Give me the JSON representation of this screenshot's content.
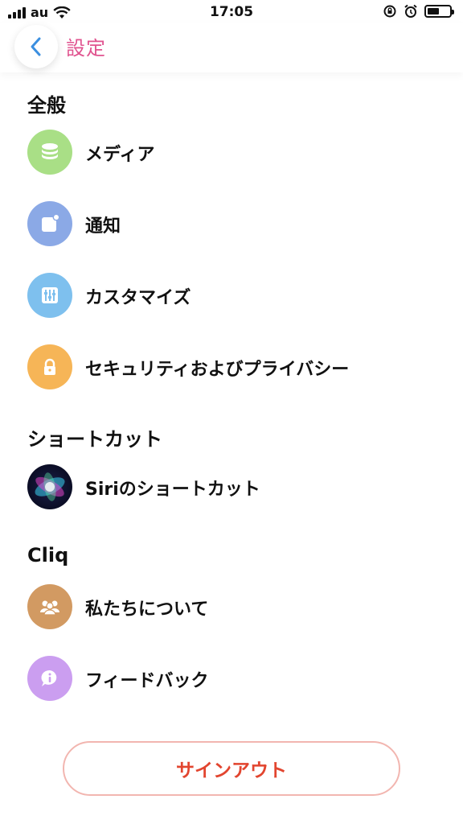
{
  "status_bar": {
    "carrier": "au",
    "time": "17:05"
  },
  "nav": {
    "title": "設定"
  },
  "sections": {
    "general": {
      "title": "全般",
      "items": [
        {
          "label": "メディア",
          "icon": "database-icon",
          "color": "#a9df86"
        },
        {
          "label": "通知",
          "icon": "notification-icon",
          "color": "#8ba9e6"
        },
        {
          "label": "カスタマイズ",
          "icon": "sliders-icon",
          "color": "#7ec0ee"
        },
        {
          "label": "セキュリティおよびプライバシー",
          "icon": "lock-icon",
          "color": "#f6b557"
        }
      ]
    },
    "shortcuts": {
      "title": "ショートカット",
      "items": [
        {
          "label": "Siriのショートカット",
          "icon": "siri-icon"
        }
      ]
    },
    "cliq": {
      "title": "Cliq",
      "items": [
        {
          "label": "私たちについて",
          "icon": "people-icon",
          "color": "#d29a62"
        },
        {
          "label": "フィードバック",
          "icon": "info-bubble-icon",
          "color": "#cb9ef0"
        }
      ]
    }
  },
  "signout": {
    "label": "サインアウト",
    "color": "#e2452f"
  }
}
